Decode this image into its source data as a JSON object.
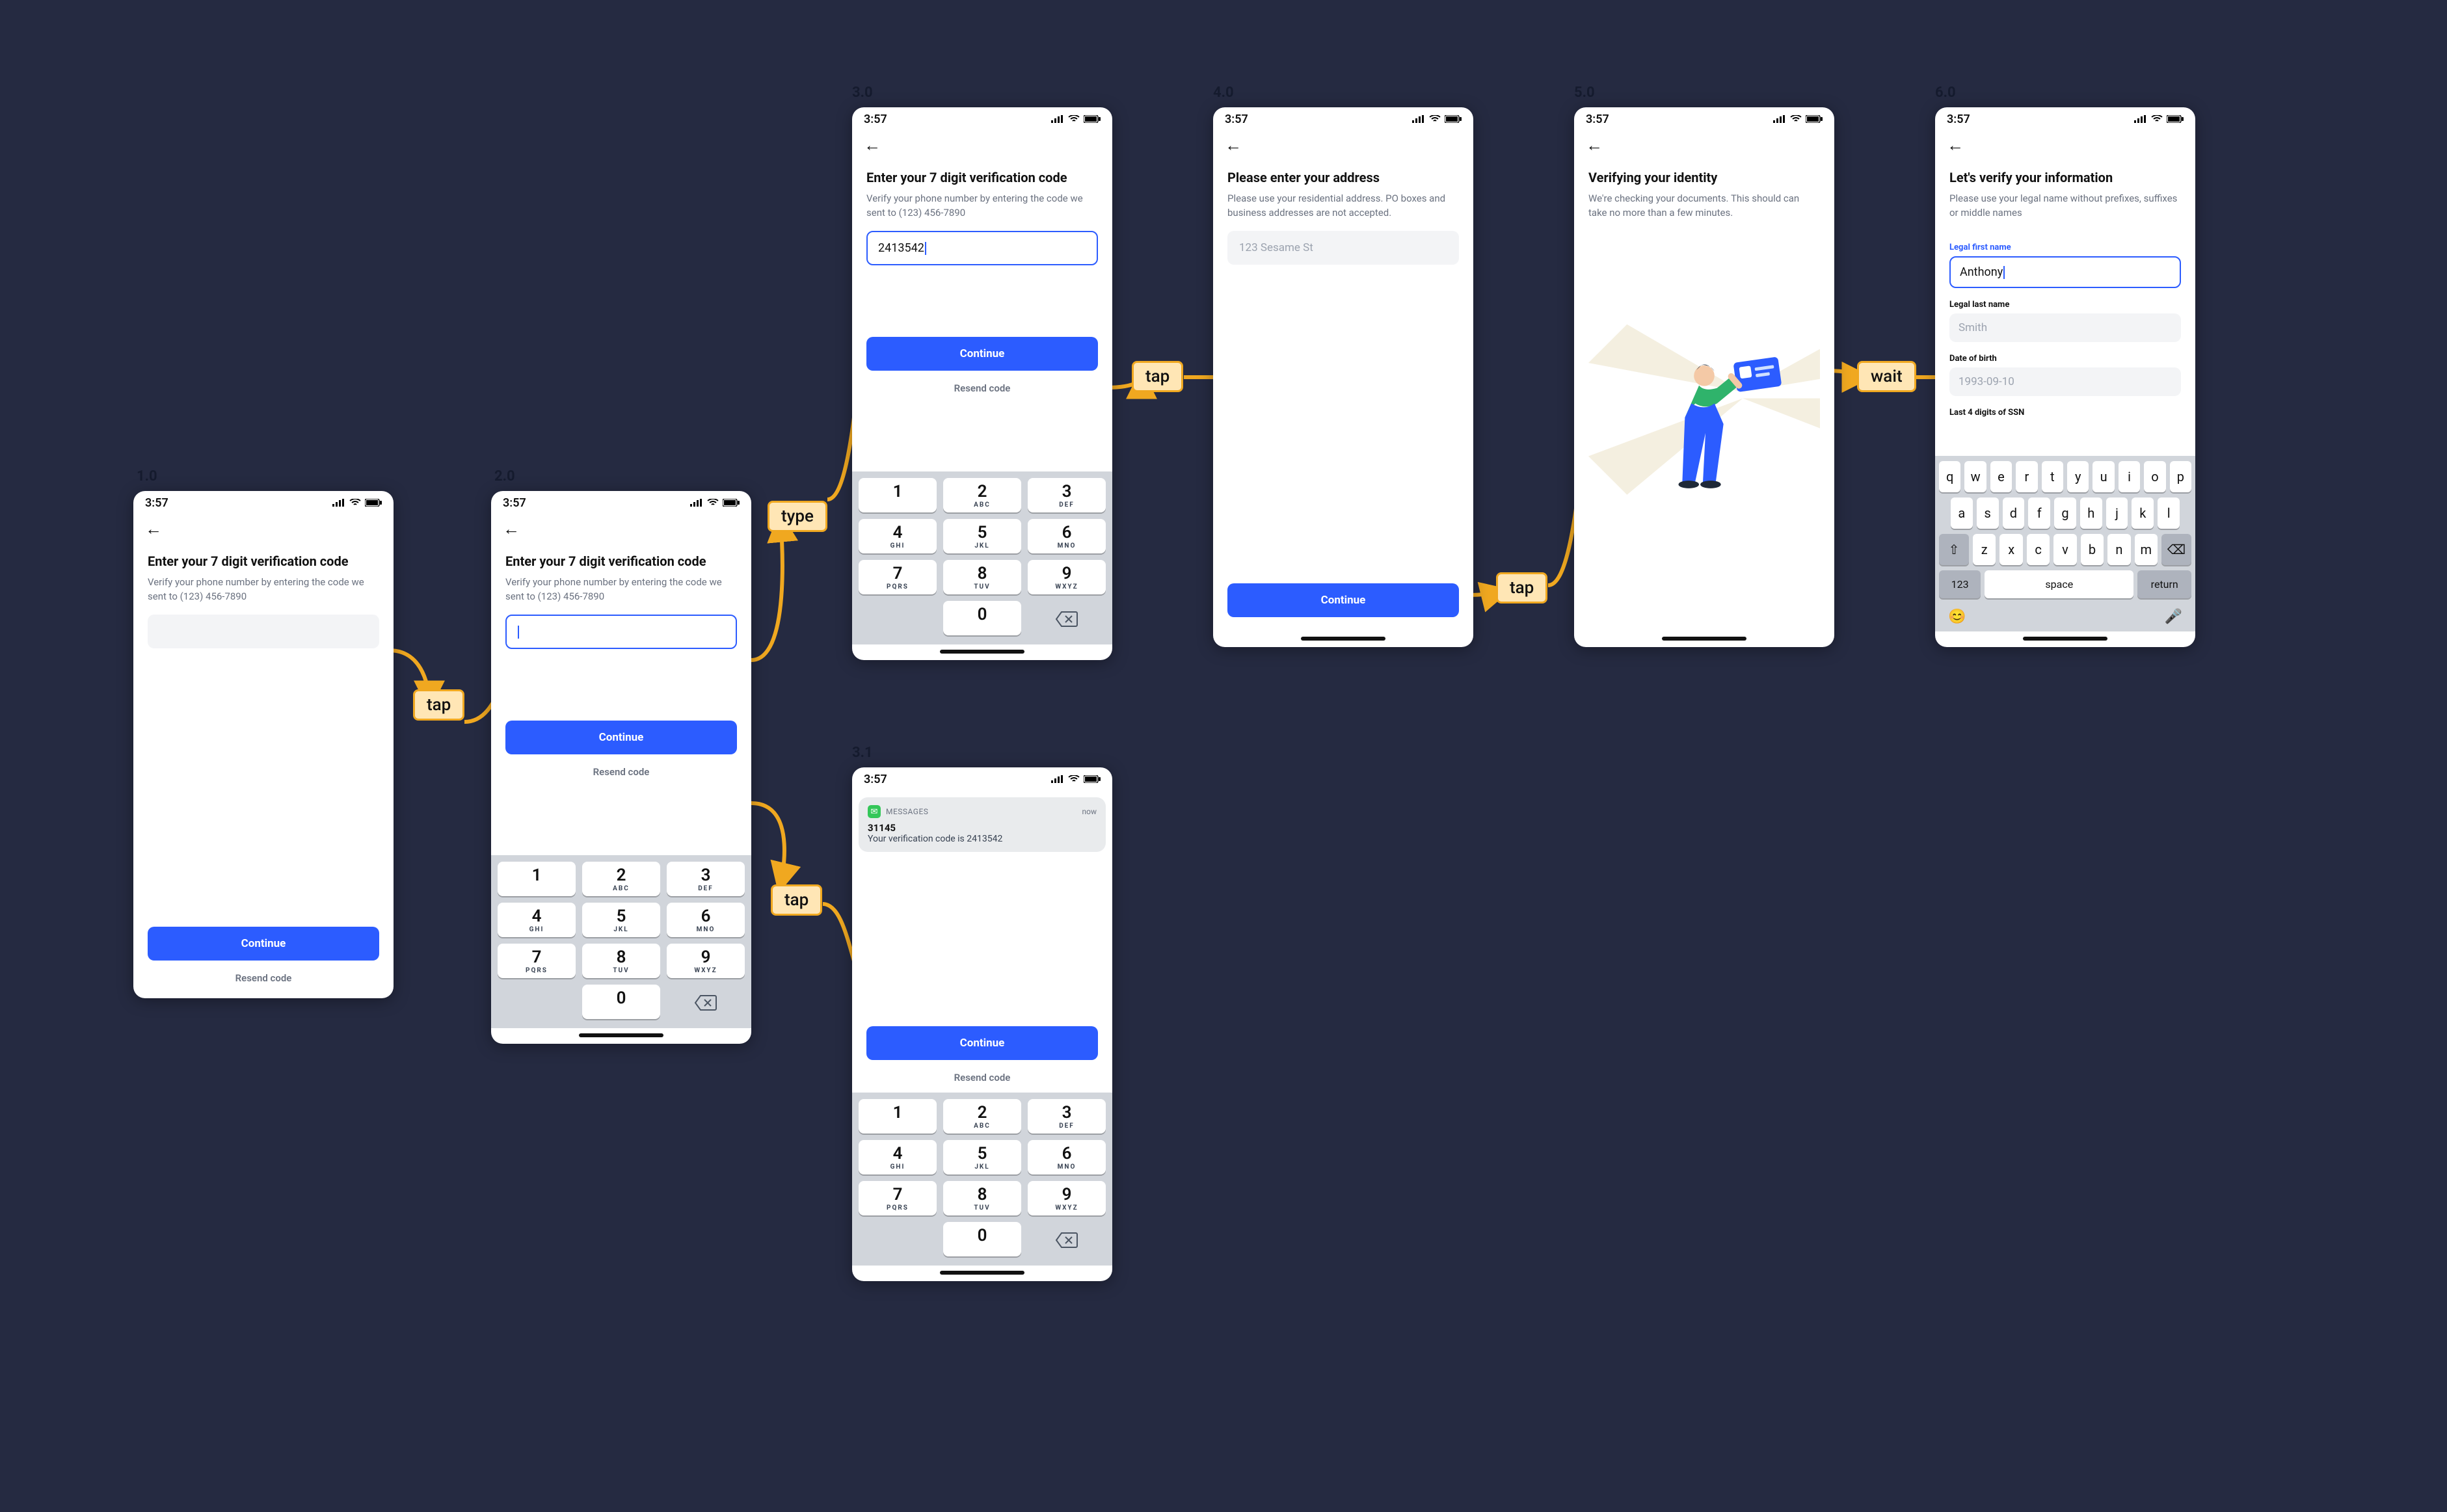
{
  "status_time": "3:57",
  "steps": {
    "s1": "1.0",
    "s2": "2.0",
    "s3": "3.0",
    "s31": "3.1",
    "s4": "4.0",
    "s5": "5.0",
    "s6": "6.0"
  },
  "actions": {
    "a12": "tap",
    "a23": "type",
    "a2_31": "tap",
    "a34": "tap",
    "a45": "tap",
    "a56": "wait"
  },
  "screen1": {
    "title": "Enter your 7 digit verification code",
    "sub": "Verify your phone number by entering the code we sent to (123) 456-7890",
    "continue": "Continue",
    "resend": "Resend code"
  },
  "screen2": {
    "title": "Enter your 7 digit verification code",
    "sub": "Verify your phone number by entering the code we sent to (123) 456-7890",
    "value": "",
    "continue": "Continue",
    "resend": "Resend code"
  },
  "screen3": {
    "title": "Enter your 7 digit verification code",
    "sub": "Verify your phone number by entering the code we sent to (123) 456-7890",
    "value": "2413542",
    "continue": "Continue",
    "resend": "Resend code"
  },
  "screen31": {
    "notif_app": "MESSAGES",
    "notif_time": "now",
    "notif_sender": "31145",
    "notif_msg": "Your verification code is 2413542",
    "continue": "Continue",
    "resend": "Resend code"
  },
  "screen4": {
    "title": "Please enter your address",
    "sub": "Please use your residential address. PO boxes and business addresses are not accepted.",
    "placeholder": "123 Sesame St",
    "continue": "Continue"
  },
  "screen5": {
    "title": "Verifying your identity",
    "sub": "We're checking your documents. This should can take no more than a few minutes."
  },
  "screen6": {
    "title": "Let's verify your information",
    "sub": "Please use your legal name without prefixes, suffixes or middle names",
    "first_label": "Legal first name",
    "first_value": "Anthony",
    "last_label": "Legal last name",
    "last_placeholder": "Smith",
    "dob_label": "Date of birth",
    "dob_placeholder": "1993-09-10",
    "ssn_label": "Last 4 digits of SSN"
  },
  "numpad": {
    "k1": "1",
    "k2": "2",
    "k3": "3",
    "k4": "4",
    "k5": "5",
    "k6": "6",
    "k7": "7",
    "k8": "8",
    "k9": "9",
    "k0": "0",
    "l2": "ABC",
    "l3": "DEF",
    "l4": "GHI",
    "l5": "JKL",
    "l6": "MNO",
    "l7": "PQRS",
    "l8": "TUV",
    "l9": "WXYZ"
  },
  "kbd": {
    "r1": [
      "q",
      "w",
      "e",
      "r",
      "t",
      "y",
      "u",
      "i",
      "o",
      "p"
    ],
    "r2": [
      "a",
      "s",
      "d",
      "f",
      "g",
      "h",
      "j",
      "k",
      "l"
    ],
    "r3": [
      "z",
      "x",
      "c",
      "v",
      "b",
      "n",
      "m"
    ],
    "num": "123",
    "space": "space",
    "ret": "return"
  }
}
